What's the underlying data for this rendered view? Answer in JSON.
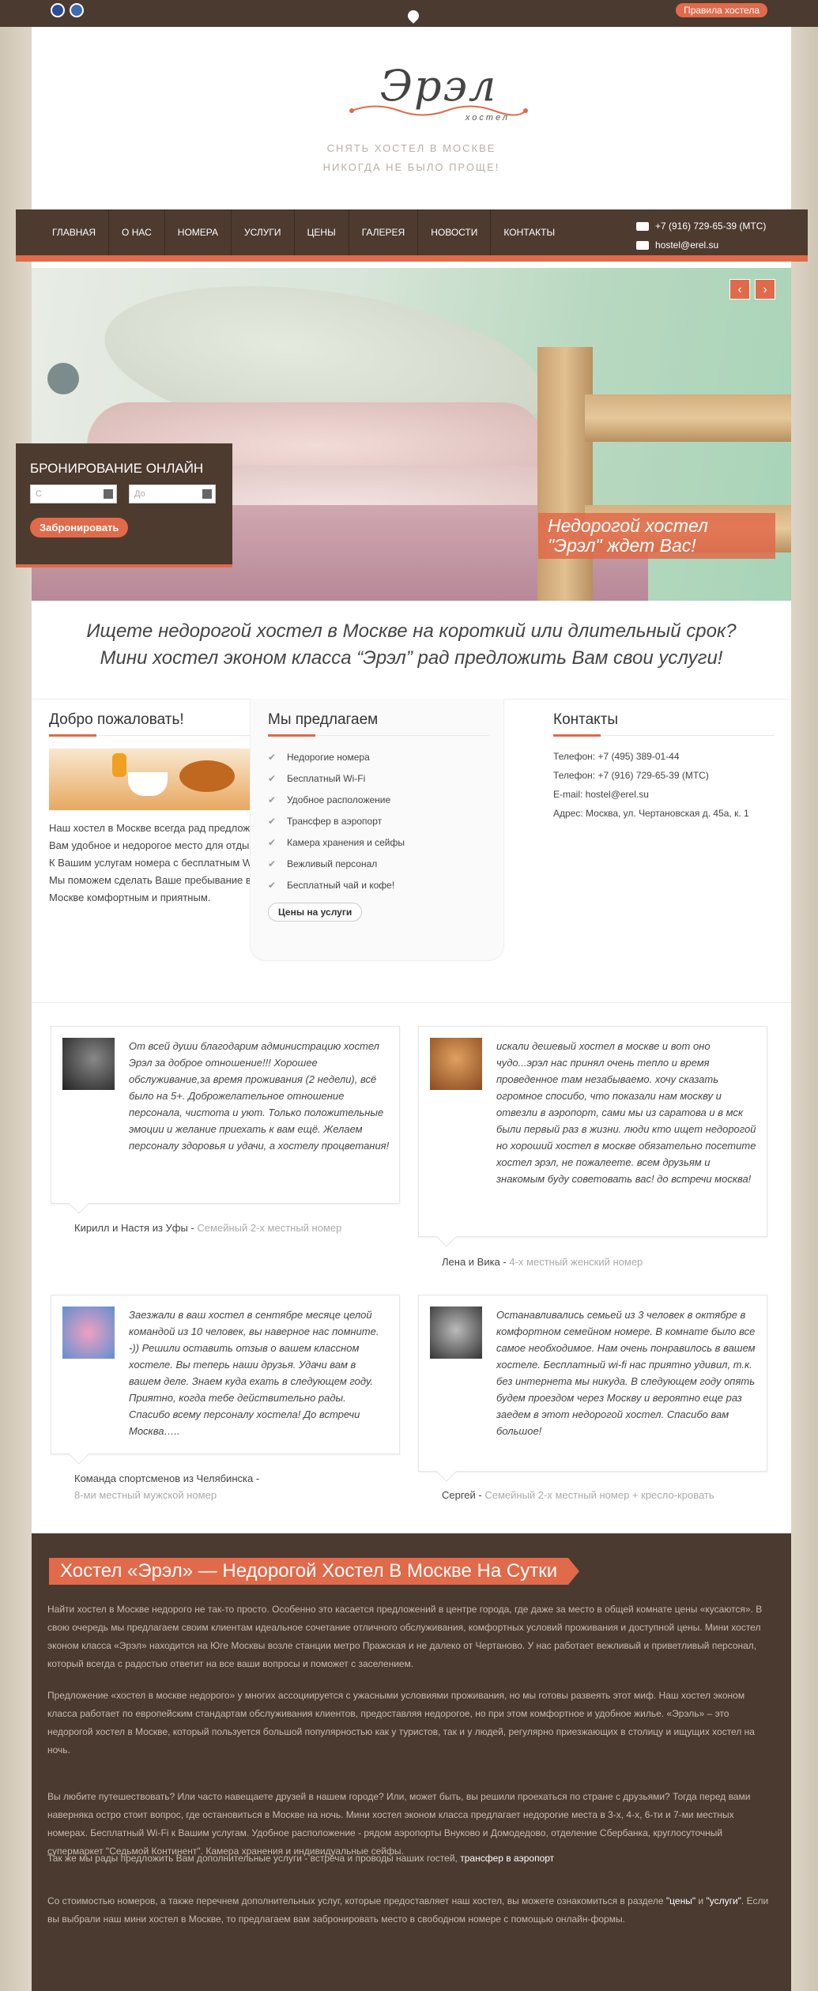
{
  "topbar": {
    "rules_label": "Правила хостела"
  },
  "logo": {
    "name": "Эрэл",
    "sub": "хостел"
  },
  "tagline": {
    "line1": "СНЯТЬ ХОСТЕЛ В МОСКВЕ",
    "line2": "НИКОГДА НЕ БЫЛО ПРОЩЕ!"
  },
  "nav": {
    "items": [
      "ГЛАВНАЯ",
      "О НАС",
      "НОМЕРА",
      "УСЛУГИ",
      "ЦЕНЫ",
      "ГАЛЕРЕЯ",
      "НОВОСТИ",
      "КОНТАКТЫ"
    ],
    "phone": "+7 (916) 729-65-39 (МТС)",
    "email": "hostel@erel.su"
  },
  "hero": {
    "caption": "Недорогой хостел \"Эрэл\" ждет Вас!",
    "prev": "‹",
    "next": "›"
  },
  "booking": {
    "title": "БРОНИРОВАНИЕ ОНЛАЙН",
    "from_placeholder": "С",
    "to_placeholder": "До",
    "button": "Забронировать"
  },
  "intro": {
    "line1": "Ищете недорогой хостел в Москве на короткий или длительный срок?",
    "line2": "Мини хостел эконом класса “Эрэл” рад предложить Вам свои услуги!"
  },
  "welcome": {
    "title": "Добро пожаловать!",
    "text": "Наш хостел в Москве всегда рад предложить Вам удобное и недорогое место для отдыха. К Вашим услугам номера с бесплатным Wi-Fi. Мы поможем сделать Ваше пребывание в Москве комфортным и приятным."
  },
  "offer": {
    "title": "Мы предлагаем",
    "items": [
      "Недорогие номера",
      "Бесплатный Wi-Fi",
      "Удобное расположение",
      "Трансфер в аэропорт",
      "Камера хранения и сейфы",
      "Вежливый персонал",
      "Бесплатный чай и кофе!"
    ],
    "button": "Цены на услуги"
  },
  "contacts": {
    "title": "Контакты",
    "lines": [
      "Телефон: +7 (495) 389-01-44",
      "Телефон: +7 (916) 729-65-39 (МТС)",
      "E-mail: hostel@erel.su",
      "Адрес: Москва, ул. Чертановская д. 45а, к. 1"
    ]
  },
  "reviews": [
    {
      "text": "От всей души благодарим администрацию хостел Эрэл за доброе отношение!!! Хорошее обслуживание,за время проживания (2 недели), всё было на 5+. Доброжелательное отношение персонала, чистота и уют. Только положительные эмоции и желание приехать к вам ещё. Желаем персоналу здоровья и удачи, а хостелу процветания!",
      "author": "Кирилл и Настя из Уфы",
      "room": "Семейный 2-х местный номер"
    },
    {
      "text": "искали дешевый хостел в москве и вот оно чудо...эрэл нас принял очень тепло и время проведенное там незабываемо. хочу сказать огромное спосибо, что показали нам москву и отвезли в аэропорт, сами мы из саратова и в мск были первый раз в жизни. люди кто ищет недорогой но хороший хостел в москве обязательно посетите хостел эрэл, не пожалеете. всем друзьям и знакомым буду советовать вас! до встречи москва!",
      "author": "Лена и Вика",
      "room": "4-х местный женский номер"
    },
    {
      "text": "Заезжали в ваш хостел в сентябре месяце целой командой из 10 человек, вы наверное нас помните. -)) Решили оставить отзыв о вашем классном хостеле. Вы теперь наши друзья. Удачи вам в вашем деле. Знаем куда ехать в следующем году. Приятно, когда тебе действительно рады. Спасибо всему персоналу хостела! До встречи Москва…..",
      "author": "Команда спортсменов из Челябинска",
      "room": "8-ми местный мужской номер"
    },
    {
      "text": "Останавливались семьей из 3 человек в октябре в комфортном семейном номере. В комнате было все самое необходимое. Нам очень понравилось в вашем хостеле. Бесплатный wi-fi нас приятно удивил, т.к. без интернета мы никуда. В следующем году опять будем проездом через Москву и вероятно еще раз заедем в этот недорогой хостел. Спасибо вам большое!",
      "author": "Сергей",
      "room": "Семейный 2-х местный номер + кресло-кровать"
    }
  ],
  "seo": {
    "title": "Хостел «Эрэл» — Недорогой Хостел В Москве На Сутки",
    "p1": "Найти хостел в Москве недорого не так-то просто. Особенно это касается предложений в центре города, где даже за место в общей комнате цены «кусаются». В свою очередь мы предлагаем своим клиентам идеальное сочетание отличного обслуживания, комфортных условий проживания и доступной цены. Мини хостел эконом класса «Эрэл» находится на Юге Москвы возле станции метро Пражская и не далеко от Чертаново. У нас работает вежливый и приветливый персонал, который всегда с радостью ответит на все ваши вопросы и поможет с заселением.",
    "p2": "Предложение «хостел в москве недорого» у многих ассоциируется с ужасными условиями проживания, но мы готовы развеять этот миф. Наш хостел эконом класса работает по европейским стандартам обслуживания клиентов, предоставляя недорогое, но при этом комфортное и удобное жилье. «Эрэль» – это недорогой хостел в Москве, который пользуется большой популярностью как у туристов, так и у людей, регулярно приезжающих в столицу и ищущих хостел на ночь.",
    "p3": "Вы любите путешествовать? Или часто навещаете друзей в нашем городе? Или, может быть, вы решили проехаться по стране с друзьями? Тогда перед вами наверняка остро стоит вопрос, где остановиться в Москве на ночь. Мини хостел эконом класса предлагает недорогие места в 3-х, 4-х, 6-ти и 7-ми местных номерах. Бесплатный Wi-Fi к Вашим услугам. Удобное расположение - рядом аэропорты Внуково и Домодедово, отделение Сбербанка, круглосуточный супермаркет \"Седьмой Континент\". Камера хранения и индивидуальные сейфы.",
    "p4_text": "Так же мы рады предложить Вам дополнительные услуги - встреча и проводы наших гостей, ",
    "p4_link": "трансфер в аэропорт",
    "p5_a": "Со стоимостью номеров, а также перечнем дополнительных услуг, которые предоставляет наш хостел, вы можете ознакомиться в разделе ",
    "p5_link1": "\"цены\"",
    "p5_and": " и ",
    "p5_link2": "\"услуги\"",
    "p5_b": ". Если вы выбрали наш мини хостел в Москве, то предлагаем вам забронировать место в свободном номере с помощью онлайн-формы."
  }
}
